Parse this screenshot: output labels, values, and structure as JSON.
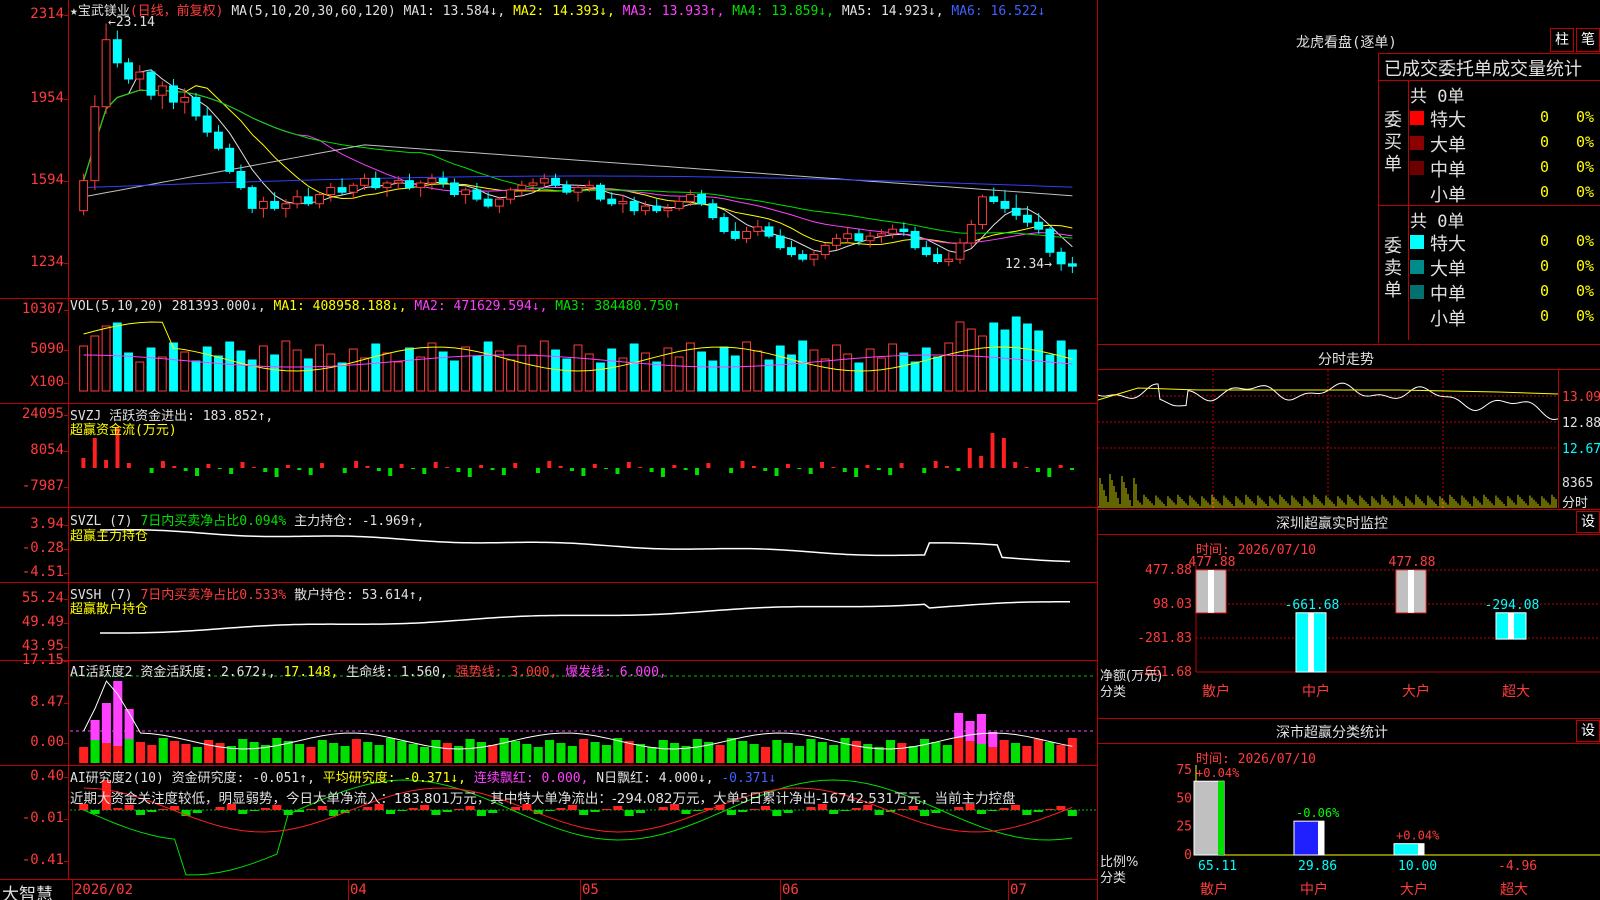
{
  "stock": {
    "title": "★宝武镁业",
    "mode": "(日线，前复权)",
    "ma_header": [
      {
        "text": "MA(5,10,20,30,60,120)",
        "cls": "w"
      },
      {
        "text": "MA1: 13.584↓,",
        "cls": "w"
      },
      {
        "text": "MA2: 14.393↓,",
        "cls": "y"
      },
      {
        "text": "MA3: 13.933↑,",
        "cls": "m"
      },
      {
        "text": "MA4: 13.859↓,",
        "cls": "g"
      },
      {
        "text": "MA5: 14.923↓,",
        "cls": "w"
      },
      {
        "text": "MA6: 16.522↓",
        "cls": "b"
      }
    ],
    "high_label": "←23.14",
    "low_label": "12.34→",
    "y_labels": [
      "2314",
      "1954",
      "1594",
      "1234"
    ],
    "candles": [
      [
        15.0,
        16.6,
        14.8,
        16.3
      ],
      [
        16.3,
        20.0,
        15.9,
        19.5
      ],
      [
        19.5,
        23.1,
        19.2,
        22.4
      ],
      [
        22.4,
        22.8,
        21.2,
        21.4
      ],
      [
        21.4,
        21.6,
        20.5,
        20.7
      ],
      [
        20.7,
        21.3,
        20.2,
        21.0
      ],
      [
        21.0,
        21.1,
        19.8,
        20.0
      ],
      [
        20.0,
        20.6,
        19.4,
        20.4
      ],
      [
        20.4,
        20.7,
        19.4,
        19.7
      ],
      [
        19.7,
        20.3,
        19.2,
        19.9
      ],
      [
        19.9,
        20.1,
        18.9,
        19.1
      ],
      [
        19.1,
        19.5,
        18.2,
        18.4
      ],
      [
        18.4,
        18.7,
        17.6,
        17.7
      ],
      [
        17.7,
        17.9,
        16.6,
        16.7
      ],
      [
        16.7,
        17.0,
        15.9,
        16.0
      ],
      [
        16.0,
        16.1,
        14.9,
        15.1
      ],
      [
        15.1,
        15.6,
        14.7,
        15.4
      ],
      [
        15.4,
        15.8,
        15.0,
        15.1
      ],
      [
        15.1,
        15.5,
        14.7,
        15.3
      ],
      [
        15.3,
        15.9,
        15.1,
        15.6
      ],
      [
        15.6,
        16.0,
        15.2,
        15.3
      ],
      [
        15.3,
        15.8,
        15.1,
        15.7
      ],
      [
        15.7,
        16.2,
        15.4,
        16.0
      ],
      [
        16.0,
        16.4,
        15.7,
        15.8
      ],
      [
        15.8,
        16.2,
        15.5,
        16.1
      ],
      [
        16.1,
        16.6,
        15.9,
        16.4
      ],
      [
        16.4,
        16.7,
        15.9,
        16.0
      ],
      [
        16.0,
        16.3,
        15.6,
        16.2
      ],
      [
        16.2,
        16.5,
        15.9,
        16.3
      ],
      [
        16.3,
        16.6,
        15.9,
        16.0
      ],
      [
        16.0,
        16.3,
        15.6,
        16.2
      ],
      [
        16.2,
        16.6,
        15.9,
        16.4
      ],
      [
        16.4,
        16.7,
        16.0,
        16.2
      ],
      [
        16.2,
        16.4,
        15.6,
        15.7
      ],
      [
        15.7,
        16.0,
        15.3,
        15.9
      ],
      [
        15.9,
        16.2,
        15.4,
        15.5
      ],
      [
        15.5,
        15.8,
        15.1,
        15.2
      ],
      [
        15.2,
        15.6,
        14.9,
        15.5
      ],
      [
        15.5,
        16.0,
        15.3,
        15.9
      ],
      [
        15.9,
        16.3,
        15.6,
        16.1
      ],
      [
        16.1,
        16.4,
        15.8,
        16.2
      ],
      [
        16.2,
        16.6,
        16.0,
        16.4
      ],
      [
        16.4,
        16.6,
        16.0,
        16.1
      ],
      [
        16.1,
        16.3,
        15.7,
        15.8
      ],
      [
        15.8,
        16.1,
        15.4,
        16.0
      ],
      [
        16.0,
        16.3,
        15.8,
        16.1
      ],
      [
        16.1,
        16.2,
        15.4,
        15.5
      ],
      [
        15.5,
        15.8,
        15.2,
        15.3
      ],
      [
        15.3,
        15.7,
        14.9,
        15.4
      ],
      [
        15.4,
        15.6,
        14.8,
        15.0
      ],
      [
        15.0,
        15.4,
        14.8,
        15.2
      ],
      [
        15.2,
        15.5,
        14.9,
        15.0
      ],
      [
        15.0,
        15.3,
        14.7,
        15.1
      ],
      [
        15.1,
        15.6,
        15.0,
        15.4
      ],
      [
        15.4,
        15.9,
        15.2,
        15.7
      ],
      [
        15.7,
        15.9,
        15.2,
        15.3
      ],
      [
        15.3,
        15.5,
        14.6,
        14.7
      ],
      [
        14.7,
        14.9,
        14.0,
        14.1
      ],
      [
        14.1,
        14.5,
        13.7,
        13.8
      ],
      [
        13.8,
        14.3,
        13.6,
        14.1
      ],
      [
        14.1,
        14.6,
        13.9,
        14.3
      ],
      [
        14.3,
        14.5,
        13.8,
        13.9
      ],
      [
        13.9,
        14.2,
        13.3,
        13.4
      ],
      [
        13.4,
        13.7,
        13.0,
        13.1
      ],
      [
        13.1,
        13.3,
        12.8,
        12.9
      ],
      [
        12.9,
        13.3,
        12.6,
        13.1
      ],
      [
        13.1,
        13.6,
        12.9,
        13.5
      ],
      [
        13.5,
        14.0,
        13.3,
        13.8
      ],
      [
        13.8,
        14.3,
        13.6,
        14.0
      ],
      [
        14.0,
        14.2,
        13.5,
        13.7
      ],
      [
        13.7,
        14.1,
        13.4,
        13.9
      ],
      [
        13.9,
        14.2,
        13.6,
        14.0
      ],
      [
        14.0,
        14.4,
        13.8,
        14.2
      ],
      [
        14.2,
        14.5,
        13.9,
        14.1
      ],
      [
        14.1,
        14.3,
        13.3,
        13.4
      ],
      [
        13.4,
        13.7,
        13.0,
        13.1
      ],
      [
        13.1,
        13.4,
        12.7,
        12.8
      ],
      [
        12.8,
        13.2,
        12.6,
        12.9
      ],
      [
        12.9,
        13.8,
        12.7,
        13.6
      ],
      [
        13.6,
        14.6,
        13.4,
        14.4
      ],
      [
        14.4,
        15.7,
        14.2,
        15.6
      ],
      [
        15.6,
        16.0,
        15.3,
        15.4
      ],
      [
        15.4,
        15.9,
        14.9,
        15.1
      ],
      [
        15.1,
        15.7,
        14.6,
        14.8
      ],
      [
        14.8,
        15.2,
        14.3,
        14.5
      ],
      [
        14.5,
        14.9,
        14.0,
        14.2
      ],
      [
        14.2,
        14.3,
        13.0,
        13.2
      ],
      [
        13.2,
        13.4,
        12.4,
        12.7
      ],
      [
        12.7,
        13.0,
        12.3,
        12.6
      ]
    ],
    "chart_range": [
      12.0,
      23.6
    ]
  },
  "vol": {
    "header": [
      {
        "text": "VOL(5,10,20)",
        "cls": "w"
      },
      {
        "text": "281393.000↓,",
        "cls": "w"
      },
      {
        "text": "MA1: 408958.188↓,",
        "cls": "y"
      },
      {
        "text": "MA2: 471629.594↓,",
        "cls": "m"
      },
      {
        "text": "MA3: 384480.750↑",
        "cls": "g"
      }
    ],
    "y_labels": [
      "10307",
      "5090",
      "X100"
    ]
  },
  "svzj": {
    "header": [
      {
        "text": "SVZJ",
        "cls": "w"
      },
      {
        "text": "活跃资金进出: 183.852↑,",
        "cls": "w"
      }
    ],
    "subtitle": "超赢资金流(万元)",
    "y_labels": [
      "24095",
      "8054",
      "-7987"
    ]
  },
  "svzl": {
    "header": [
      {
        "text": "SVZL (7)",
        "cls": "w"
      },
      {
        "text": "7日内买卖净占比0.094%",
        "cls": "g"
      },
      {
        "text": "主力持仓: -1.969↑,",
        "cls": "w"
      }
    ],
    "subtitle": "超赢主力持仓",
    "y_labels": [
      "3.94",
      "-0.28",
      "-4.51"
    ]
  },
  "svsh": {
    "header": [
      {
        "text": "SVSH (7)",
        "cls": "w"
      },
      {
        "text": "7日内买卖净占比0.533%",
        "cls": "r"
      },
      {
        "text": "散户持仓: 53.614↑,",
        "cls": "w"
      }
    ],
    "subtitle": "超赢散户持仓",
    "y_labels": [
      "55.24",
      "49.49",
      "43.95"
    ]
  },
  "ai1": {
    "header": [
      {
        "text": "AI活跃度2",
        "cls": "w"
      },
      {
        "text": "资金活跃度: 2.672↓,",
        "cls": "w"
      },
      {
        "text": "17.148,",
        "cls": "y"
      },
      {
        "text": "生命线: 1.560,",
        "cls": "w"
      },
      {
        "text": "强势线: 3.000,",
        "cls": "r"
      },
      {
        "text": "爆发线: 6.000,",
        "cls": "m"
      }
    ],
    "y_labels": [
      "17.15",
      "8.47",
      "0.00"
    ]
  },
  "ai2": {
    "header": [
      {
        "text": "AI研究度2(10)",
        "cls": "w"
      },
      {
        "text": "资金研究度: -0.051↑,",
        "cls": "w"
      },
      {
        "text": "平均研究度: -0.371↓,",
        "cls": "y"
      },
      {
        "text": "连续飘红: 0.000,",
        "cls": "m"
      },
      {
        "text": "N日飘红: 4.000↓,",
        "cls": "w"
      },
      {
        "text": "-0.371↓",
        "cls": "b"
      }
    ],
    "comment": "近期大资金关注度较低，明显弱势，今日大单净流入：183.801万元，其中特大单净流出：-294.082万元，大单5日累计净出-16742.531万元，当前主力控盘",
    "y_labels": [
      "0.40",
      "-0.01",
      "-0.41"
    ]
  },
  "bottom": {
    "brand": "大智慧",
    "dates": [
      "2026/02",
      "04",
      "05",
      "06",
      "07"
    ]
  },
  "dragon": {
    "title": "龙虎看盘(逐单)",
    "tab_bar": "柱",
    "tab_tick": "笔",
    "sub_title": "已成交委托单成交量统计",
    "buy_label": "委买单",
    "sell_label": "委卖单",
    "buy_total": "共 0单",
    "sell_total": "共 0单",
    "buy_rows": [
      {
        "name": "特大",
        "vol": "0",
        "pct": "0%",
        "color": "#ff0000"
      },
      {
        "name": "大单",
        "vol": "0",
        "pct": "0%",
        "color": "#8b0000"
      },
      {
        "name": "中单",
        "vol": "0",
        "pct": "0%",
        "color": "#6b0000"
      },
      {
        "name": "小单",
        "vol": "0",
        "pct": "0%",
        "color": "#000000"
      }
    ],
    "sell_rows": [
      {
        "name": "特大",
        "vol": "0",
        "pct": "0%",
        "color": "#00ffff"
      },
      {
        "name": "大单",
        "vol": "0",
        "pct": "0%",
        "color": "#008b8b"
      },
      {
        "name": "中单",
        "vol": "0",
        "pct": "0%",
        "color": "#007070"
      },
      {
        "name": "小单",
        "vol": "0",
        "pct": "0%",
        "color": "#000000"
      }
    ]
  },
  "intraday": {
    "title": "分时走势",
    "prices": [
      "13.09",
      "12.88",
      "12.67"
    ],
    "vol_label": "8365",
    "time_label": "分时"
  },
  "monitor": {
    "title": "深圳超赢实时监控",
    "settings": "设",
    "time": "时间: 2026/07/10",
    "y_labels": [
      "477.88",
      "98.03",
      "-281.83",
      "-661.68"
    ],
    "axis_title": "净额(万元)",
    "axis_sub": "分类",
    "chart_data": {
      "type": "bar",
      "categories": [
        "散户",
        "中户",
        "大户",
        "超大"
      ],
      "values": [
        477.88,
        -661.68,
        477.88,
        -294.08
      ],
      "value_labels": [
        "477.88",
        "-661.68",
        "477.88",
        "-294.08"
      ],
      "ylim": [
        -661.68,
        477.88
      ]
    }
  },
  "classify": {
    "title": "深市超赢分类统计",
    "settings": "设",
    "time": "时间: 2026/07/10",
    "y_labels": [
      "75",
      "50",
      "25",
      "0"
    ],
    "axis_title": "比例%",
    "axis_sub": "分类",
    "chart_data": {
      "type": "bar",
      "categories": [
        "散户",
        "中户",
        "大户",
        "超大"
      ],
      "values": [
        65.11,
        29.86,
        10.0,
        -4.96
      ],
      "value_labels": [
        "65.11",
        "29.86",
        "10.00",
        "-4.96"
      ],
      "top_labels": [
        "+0.04%",
        "-0.06%",
        "+0.04%",
        ""
      ],
      "ylim": [
        0,
        75
      ]
    }
  }
}
